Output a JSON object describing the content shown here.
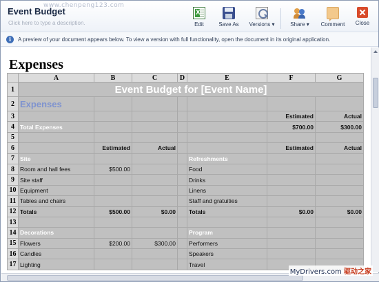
{
  "app": {
    "doc_title": "Event Budget",
    "watermark_top": "www.chenpeng123.com",
    "description_placeholder": "Click here to type a description.",
    "toolbar": [
      {
        "label": "Edit",
        "icon": "excel-edit-icon"
      },
      {
        "label": "Save As",
        "icon": "save-as-icon"
      },
      {
        "label": "Versions ▾",
        "icon": "versions-icon"
      },
      {
        "label": "Share ▾",
        "icon": "share-icon"
      },
      {
        "label": "Comment",
        "icon": "comment-icon"
      },
      {
        "label": "Close",
        "icon": "close-icon"
      }
    ],
    "info_text": "A preview of your document appears below. To view a version with full functionality, open the document in its original application."
  },
  "sheet": {
    "name": "Expenses",
    "columns": [
      "A",
      "B",
      "C",
      "D",
      "E",
      "F",
      "G"
    ],
    "rows": [
      {
        "n": "1",
        "cells": [
          "Event Budget for [Event Name]"
        ]
      },
      {
        "n": "2",
        "cells": [
          "Expenses",
          "",
          "",
          "",
          "",
          "",
          ""
        ]
      },
      {
        "n": "3",
        "cells": [
          "",
          "",
          "",
          "",
          "",
          "Estimated",
          "Actual"
        ]
      },
      {
        "n": "4",
        "cells": [
          "Total Expenses",
          "",
          "",
          "",
          "",
          "$700.00",
          "$300.00"
        ]
      },
      {
        "n": "5",
        "cells": [
          "",
          "",
          "",
          "",
          "",
          "",
          ""
        ]
      },
      {
        "n": "6",
        "cells": [
          "",
          "Estimated",
          "Actual",
          "",
          "",
          "Estimated",
          "Actual"
        ]
      },
      {
        "n": "7",
        "cells": [
          "Site",
          "",
          "",
          "",
          "Refreshments",
          "",
          ""
        ]
      },
      {
        "n": "8",
        "cells": [
          "Room and hall fees",
          "$500.00",
          "",
          "",
          "Food",
          "",
          ""
        ]
      },
      {
        "n": "9",
        "cells": [
          "Site staff",
          "",
          "",
          "",
          "Drinks",
          "",
          ""
        ]
      },
      {
        "n": "10",
        "cells": [
          "Equipment",
          "",
          "",
          "",
          "Linens",
          "",
          ""
        ]
      },
      {
        "n": "11",
        "cells": [
          "Tables and chairs",
          "",
          "",
          "",
          "Staff and gratuities",
          "",
          ""
        ]
      },
      {
        "n": "12",
        "cells": [
          "Totals",
          "$500.00",
          "$0.00",
          "",
          "Totals",
          "$0.00",
          "$0.00"
        ]
      },
      {
        "n": "13",
        "cells": [
          "",
          "",
          "",
          "",
          "",
          "",
          ""
        ]
      },
      {
        "n": "14",
        "cells": [
          "Decorations",
          "",
          "",
          "",
          "Program",
          "",
          ""
        ]
      },
      {
        "n": "15",
        "cells": [
          "Flowers",
          "$200.00",
          "$300.00",
          "",
          "Performers",
          "",
          ""
        ]
      },
      {
        "n": "16",
        "cells": [
          "Candles",
          "",
          "",
          "",
          "Speakers",
          "",
          ""
        ]
      },
      {
        "n": "17",
        "cells": [
          "Lighting",
          "",
          "",
          "",
          "Travel",
          "",
          ""
        ]
      }
    ]
  },
  "footer_watermark": {
    "site": "MyDrivers.com",
    "cn": "驱动之家"
  },
  "colors": {
    "accent_bar": "#7f93cf",
    "grid_bg": "#c0c0c0",
    "header_bg": "#dcdcdc"
  }
}
